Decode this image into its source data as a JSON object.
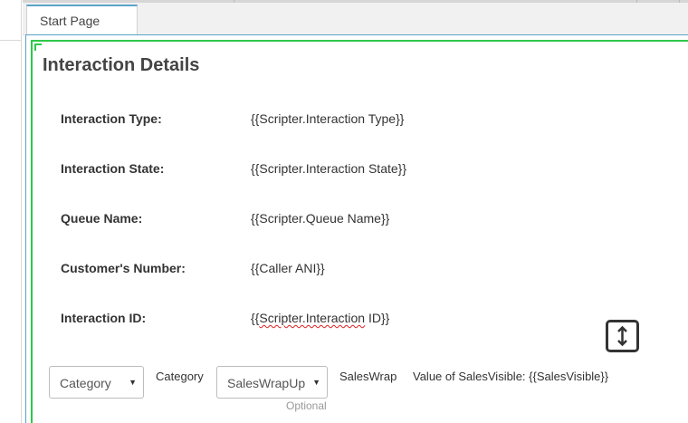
{
  "tabs": [
    {
      "label": "Start Page",
      "active": true
    }
  ],
  "page": {
    "title": "Interaction Details"
  },
  "fields": [
    {
      "label": "Interaction Type:",
      "value": "{{Scripter.Interaction Type}}"
    },
    {
      "label": "Interaction State:",
      "value": "{{Scripter.Interaction State}}"
    },
    {
      "label": "Queue Name:",
      "value": "{{Scripter.Queue Name}}"
    },
    {
      "label": "Customer's Number:",
      "value": "{{Caller ANI}}"
    },
    {
      "label": "Interaction ID:",
      "value_prefix": "{{",
      "value_spell": "Scripter.Interaction",
      "value_suffix": " ID}}"
    }
  ],
  "controls": {
    "category_select": {
      "value": "Category"
    },
    "category_label": "Category",
    "saleswrap_select": {
      "value": "SalesWrapUp"
    },
    "saleswrap_label": "SalesWrap",
    "sales_visible_text": "Value of SalesVisible: {{SalesVisible}}",
    "optional_hint": "Optional"
  },
  "icons": {
    "resize": "vertical-resize-icon",
    "dropdown": "caret-down-icon"
  },
  "colors": {
    "tab_accent": "#5aa3c8",
    "container_border": "#2ec84a",
    "spellcheck": "#e02020"
  }
}
